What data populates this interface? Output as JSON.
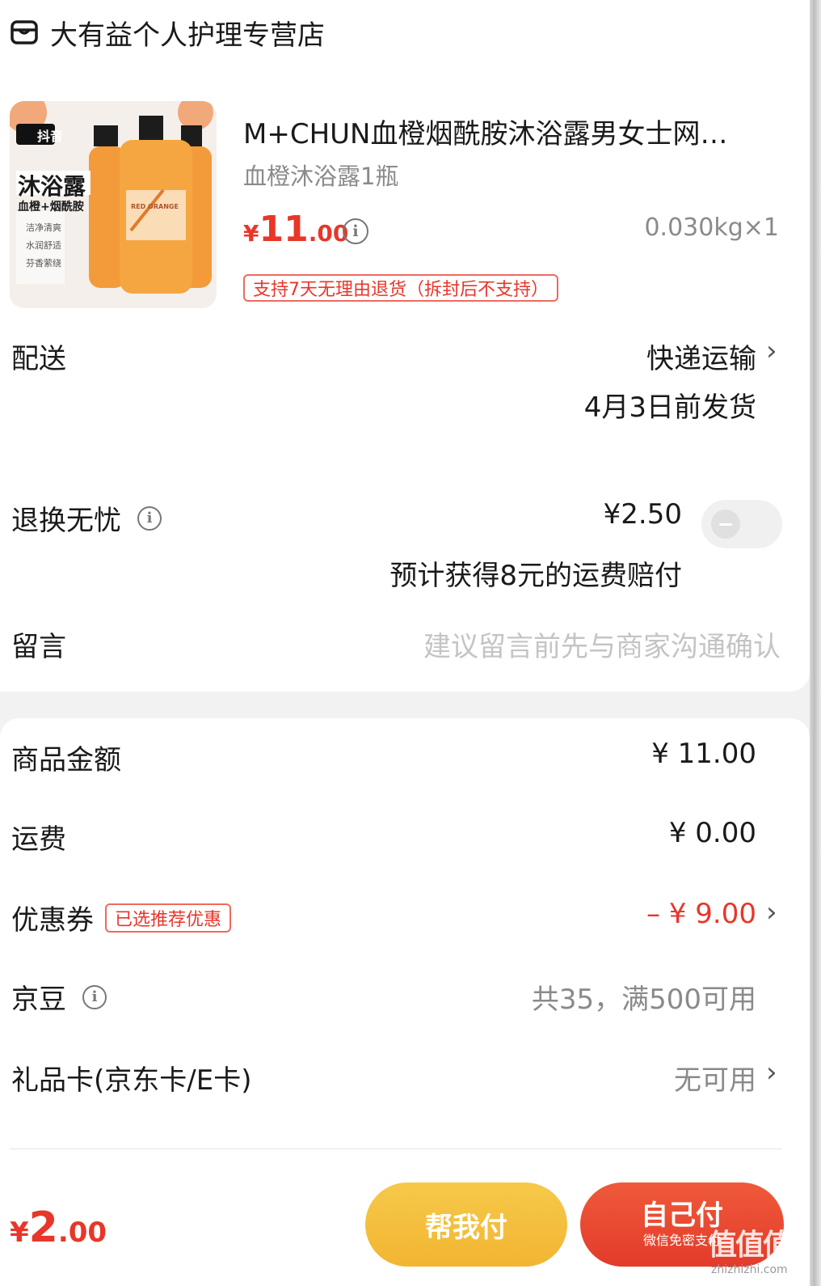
{
  "store": {
    "name": "大有益个人护理专营店",
    "icon": "store-icon"
  },
  "product": {
    "title": "M+CHUN血橙烟酰胺沐浴露男女士网…",
    "spec": "血橙沐浴露1瓶",
    "price_currency": "¥",
    "price_int": "11",
    "price_dec": ".00",
    "weight": "0.030kg×1",
    "return_tag": "支持7天无理由退货（拆封后不支持）",
    "image": {
      "badge": "抖音",
      "title": "沐浴露",
      "subtitle": "血橙+烟酰胺",
      "features": [
        "洁净清爽",
        "水润舒适",
        "芬香萦绕"
      ],
      "bottle_label": "RED ORANGE"
    }
  },
  "delivery": {
    "label": "配送",
    "method": "快递运输",
    "date": "4月3日前发货"
  },
  "worry_free": {
    "label": "退换无忧",
    "price": "¥2.50",
    "note": "预计获得8元的运费赔付",
    "enabled": false
  },
  "message": {
    "label": "留言",
    "placeholder": "建议留言前先与商家沟通确认"
  },
  "summary": {
    "goods_amount": {
      "label": "商品金额",
      "value": "¥ 11.00"
    },
    "shipping": {
      "label": "运费",
      "value": "¥ 0.00"
    },
    "coupon": {
      "label": "优惠券",
      "tag": "已选推荐优惠",
      "value": "– ¥ 9.00"
    },
    "jingdou": {
      "label": "京豆",
      "value": "共35，满500可用"
    },
    "gift_card": {
      "label": "礼品卡(京东卡/E卡)",
      "value": "无可用"
    }
  },
  "footer": {
    "total_currency": "¥",
    "total_int": "2",
    "total_dec": ".00",
    "help_pay": "帮我付",
    "self_pay": "自己付",
    "self_pay_sub": "微信免密支付",
    "watermark": "值值值",
    "watermark_url": "zhizhizhi.com"
  },
  "colors": {
    "accent": "#e8362a",
    "help_btn": "#f2b531",
    "self_btn": "#e33b2a"
  }
}
